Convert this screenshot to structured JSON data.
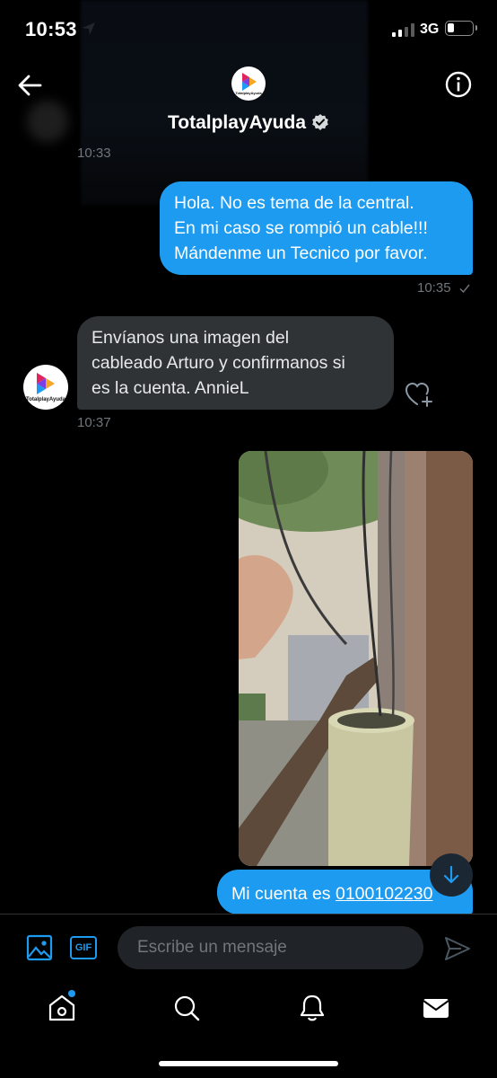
{
  "status_bar": {
    "time": "10:53",
    "network": "3G"
  },
  "header": {
    "title": "TotalplayAyuda",
    "verified": true,
    "avatar_logo_text": "TotalplayAyuda",
    "icons": [
      "back-arrow-icon",
      "verified-badge-icon",
      "info-icon"
    ]
  },
  "messages": [
    {
      "direction": "in",
      "timestamp": "10:33"
    },
    {
      "direction": "out",
      "lines": [
        "Hola. No es tema de la central.",
        "En mi caso se rompió un cable!!!",
        "Mándenme un Tecnico por favor."
      ],
      "timestamp": "10:35",
      "status": "sent"
    },
    {
      "direction": "in",
      "lines": [
        "Envíanos una imagen del",
        "cableado Arturo y confirmanos si",
        "es la cuenta. AnnieL"
      ],
      "timestamp": "10:37",
      "avatar_logo_text": "TotalplayAyuda"
    },
    {
      "direction": "out",
      "type": "photo",
      "description_icon": "photo-attachment"
    },
    {
      "direction": "out",
      "text_prefix": "Mi cuenta es ",
      "link_text": "0100102230"
    }
  ],
  "composer": {
    "placeholder": "Escribe un mensaje",
    "gif_label": "GIF"
  },
  "tabbar": {
    "items": [
      "home-icon",
      "search-icon",
      "notifications-icon",
      "messages-icon"
    ],
    "home_has_new": true
  },
  "colors": {
    "accent": "#1d9bf0",
    "incoming_bubble": "#2f3336",
    "background": "#000000",
    "muted_text": "#71767b"
  }
}
